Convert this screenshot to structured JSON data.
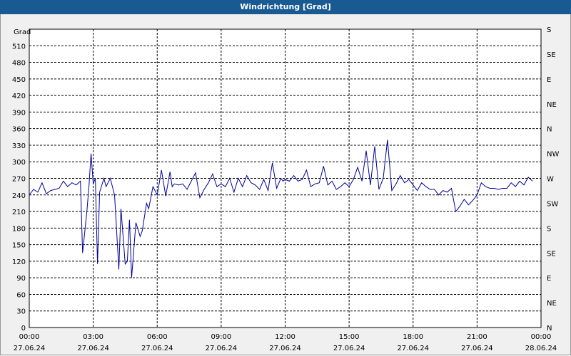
{
  "window": {
    "title": "Windrichtung [Grad]"
  },
  "chart_data": {
    "type": "line",
    "title": "Windrichtung [Grad]",
    "ylabel": "Grad",
    "ylim": [
      0,
      540
    ],
    "xlim": [
      "27.06.24 00:00",
      "28.06.24 00:00"
    ],
    "grid": true,
    "line_color": "#000099",
    "y_ticks": [
      "0",
      "30",
      "60",
      "90",
      "120",
      "150",
      "180",
      "210",
      "240",
      "270",
      "300",
      "330",
      "360",
      "390",
      "420",
      "450",
      "480",
      "510"
    ],
    "right_axis_labels": [
      "N",
      "NE",
      "E",
      "SE",
      "S",
      "SW",
      "W",
      "NW",
      "N",
      "NE",
      "E",
      "SE",
      "S"
    ],
    "x_ticks": [
      {
        "time": "00:00",
        "date": "27.06.24"
      },
      {
        "time": "03:00",
        "date": "27.06.24"
      },
      {
        "time": "06:00",
        "date": "27.06.24"
      },
      {
        "time": "09:00",
        "date": "27.06.24"
      },
      {
        "time": "12:00",
        "date": "27.06.24"
      },
      {
        "time": "15:00",
        "date": "27.06.24"
      },
      {
        "time": "18:00",
        "date": "27.06.24"
      },
      {
        "time": "21:00",
        "date": "27.06.24"
      },
      {
        "time": "00:00",
        "date": "28.06.24"
      }
    ],
    "series": [
      {
        "x_hours": [
          0.0,
          0.2,
          0.4,
          0.6,
          0.8,
          1.0,
          1.2,
          1.4,
          1.6,
          1.8,
          2.0,
          2.2,
          2.4,
          2.5,
          2.7,
          2.8,
          2.9,
          3.0,
          3.1,
          3.2,
          3.3,
          3.5,
          3.6,
          3.8,
          4.0,
          4.2,
          4.3,
          4.5,
          4.6,
          4.7,
          4.8,
          5.0,
          5.2,
          5.3,
          5.5,
          5.6,
          5.8,
          6.0,
          6.2,
          6.4,
          6.6,
          6.7,
          6.8,
          7.0,
          7.2,
          7.4,
          7.6,
          7.8,
          8.0,
          8.2,
          8.4,
          8.6,
          8.8,
          9.0,
          9.2,
          9.4,
          9.6,
          9.8,
          10.0,
          10.2,
          10.4,
          10.6,
          10.8,
          11.0,
          11.2,
          11.4,
          11.6,
          11.8,
          11.9,
          12.0,
          12.2,
          12.4,
          12.6,
          12.8,
          13.0,
          13.2,
          13.4,
          13.6,
          13.8,
          14.0,
          14.2,
          14.4,
          14.6,
          14.8,
          15.0,
          15.2,
          15.4,
          15.6,
          15.8,
          16.0,
          16.2,
          16.4,
          16.6,
          16.8,
          17.0,
          17.2,
          17.4,
          17.6,
          17.8,
          18.0,
          18.2,
          18.4,
          18.6,
          18.8,
          19.0,
          19.2,
          19.4,
          19.6,
          19.8,
          20.0,
          20.2,
          20.4,
          20.6,
          20.8,
          21.0,
          21.2,
          21.4,
          21.6,
          21.8,
          22.0,
          22.2,
          22.4,
          22.6,
          22.8,
          23.0,
          23.2,
          23.4,
          23.6,
          23.8,
          24.0
        ],
        "values": [
          240,
          250,
          245,
          262,
          242,
          248,
          250,
          252,
          265,
          255,
          262,
          258,
          265,
          135,
          210,
          255,
          315,
          260,
          270,
          115,
          245,
          270,
          255,
          270,
          240,
          105,
          215,
          115,
          120,
          195,
          90,
          190,
          165,
          175,
          225,
          215,
          255,
          240,
          285,
          238,
          282,
          255,
          260,
          258,
          260,
          250,
          265,
          280,
          235,
          250,
          262,
          278,
          255,
          260,
          255,
          270,
          245,
          270,
          255,
          275,
          262,
          258,
          250,
          268,
          248,
          298,
          252,
          270,
          265,
          268,
          265,
          275,
          265,
          268,
          285,
          255,
          260,
          262,
          292,
          258,
          265,
          250,
          255,
          262,
          255,
          268,
          290,
          265,
          320,
          258,
          328,
          250,
          270,
          340,
          248,
          260,
          275,
          262,
          268,
          258,
          248,
          262,
          255,
          250,
          250,
          240,
          248,
          245,
          252,
          210,
          220,
          232,
          222,
          230,
          240,
          262,
          255,
          252,
          252,
          250,
          252,
          252,
          262,
          255,
          265,
          258,
          272,
          265
        ]
      }
    ]
  }
}
